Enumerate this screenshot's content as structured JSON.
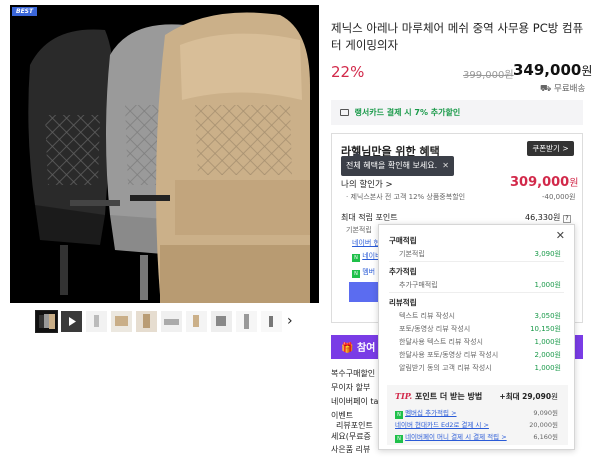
{
  "badge": "BEST",
  "product": {
    "title": "제닉스 아레나 마루체어 메쉬 중역 사무용 PC방 컴퓨터 게이밍의자",
    "discount": "22%",
    "original_price": "399,000원",
    "sale_price": "349,000",
    "sale_price_unit": "원",
    "shipping": "무료배송"
  },
  "card_banner": {
    "prefix": "랭서카드 결제 시 ",
    "highlight": "7% 추가할인",
    "suffix": ""
  },
  "benefit": {
    "title": "라헬님만을 위한 혜택",
    "coupon_button": "쿠폰받기 >",
    "tooltip": "전체 혜택을 확인해 보세요.",
    "tooltip_close": "✕",
    "my_price_label": "나의 할인가 >",
    "my_price": "309,000",
    "my_price_unit": "원",
    "discount_desc": "제닉스본사 전 고객 12% 상품중복할인",
    "discount_amount": "-40,000원",
    "max_points_label": "최대 적립 포인트",
    "max_points_value": "46,330원",
    "basic_label": "기본적립",
    "naver_label": "네이버 현",
    "membership_label": "네이버",
    "membership_short": "멤버"
  },
  "purple_strip": "참여",
  "left_lines": [
    "복수구매할인",
    "무이자 할부",
    "네이버페이 tap",
    "이벤트",
    "리뷰포인트",
    "세요(무료증",
    "사은품   리뷰"
  ],
  "popup": {
    "close": "✕",
    "sections": [
      {
        "title": "구매적립",
        "items": [
          {
            "label": "기본적립",
            "value": "3,090원"
          }
        ]
      },
      {
        "title": "추가적립",
        "items": [
          {
            "label": "추가구매적립",
            "value": "1,000원"
          }
        ]
      },
      {
        "title": "리뷰적립",
        "items": [
          {
            "label": "텍스트 리뷰 작성시",
            "value": "3,050원"
          },
          {
            "label": "포토/동영상 리뷰 작성시",
            "value": "10,150원"
          },
          {
            "label": "한달사용 텍스트 리뷰 작성시",
            "value": "1,000원"
          },
          {
            "label": "한달사용 포토/동영상 리뷰 작성시",
            "value": "2,000원"
          },
          {
            "label": "알림받기 동의 고객 리뷰 작성시",
            "value": "1,000원"
          }
        ]
      }
    ],
    "tip": {
      "label_tip": "TIP.",
      "label": "포인트 더 받는 방법",
      "max_prefix": "+최대",
      "max_value": "29,090",
      "max_unit": "원",
      "rows": [
        {
          "label": "멤버십 추가적립 >",
          "value": "9,090원"
        },
        {
          "label": "네이버 현대카드 Ed2로 결제 시 >",
          "value": "20,000원"
        },
        {
          "label": "네이버페이 머니 결제 시 결제 적립 >",
          "value": "6,160원"
        }
      ]
    }
  },
  "colors": {
    "accent_red": "#d2294a",
    "accent_green": "#1a9a4a",
    "purple": "#7a3ce6"
  }
}
